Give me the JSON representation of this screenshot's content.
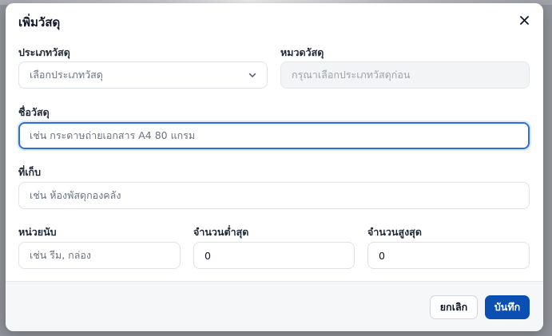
{
  "dialog": {
    "title": "เพิ่มวัสดุ",
    "close_icon": "close-icon"
  },
  "form": {
    "material_type": {
      "label": "ประเภทวัสดุ",
      "placeholder": "เลือกประเภทวัสดุ",
      "icon": "chevron-down-icon"
    },
    "material_category": {
      "label": "หมวดวัสดุ",
      "placeholder": "กรุณาเลือกประเภทวัสดุก่อน",
      "disabled": true
    },
    "material_name": {
      "label": "ชื่อวัสดุ",
      "placeholder": "เช่น กระดาษถ่ายเอกสาร A4 80 แกรม",
      "focused": true
    },
    "storage_location": {
      "label": "ที่เก็บ",
      "placeholder": "เช่น ห้องพัสดุกองคลัง"
    },
    "unit": {
      "label": "หน่วยนับ",
      "placeholder": "เช่น รีม, กล่อง"
    },
    "min_quantity": {
      "label": "จำนวนต่ำสุด",
      "value": "0"
    },
    "max_quantity": {
      "label": "จำนวนสูงสุด",
      "value": "0"
    }
  },
  "footer": {
    "cancel_label": "ยกเลิก",
    "save_label": "บันทึก"
  },
  "colors": {
    "primary": "#0b4fb3",
    "focus_ring": "#2f6fd0",
    "backdrop": "#8f9298"
  }
}
